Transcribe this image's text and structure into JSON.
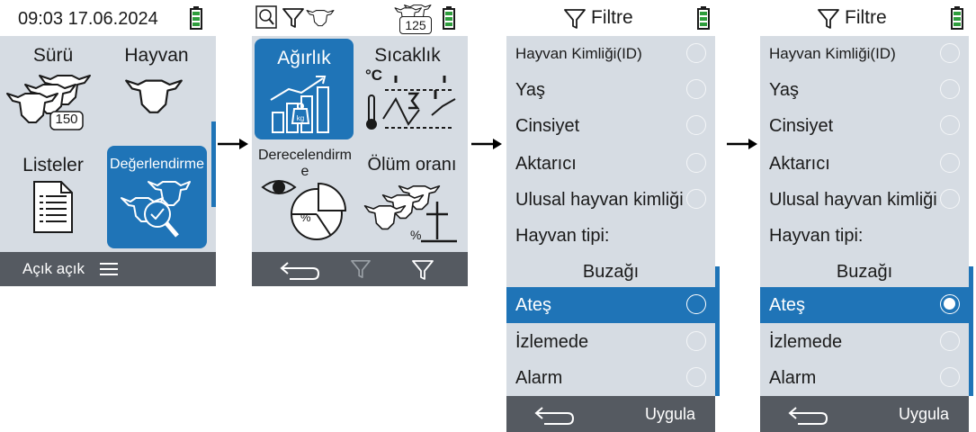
{
  "screen1": {
    "status": {
      "time_date": "09:03 17.06.2024"
    },
    "tiles": [
      {
        "label": "Sürü",
        "badge": "150"
      },
      {
        "label": "Hayvan"
      },
      {
        "label": "Listeler"
      },
      {
        "label": "Değerlendirme"
      }
    ],
    "bottom": {
      "label": "Açık açık"
    }
  },
  "screen2": {
    "status": {
      "badge": "125"
    },
    "tiles": [
      {
        "label": "Ağırlık",
        "unit": "kg"
      },
      {
        "label": "Sıcaklık",
        "unit": "°C"
      },
      {
        "label_line1": "Derecelendirm",
        "label_line2": "e"
      },
      {
        "label": "Ölüm oranı"
      }
    ]
  },
  "screen3": {
    "title": "Filtre",
    "items": [
      "Hayvan Kimliği(ID)",
      "Yaş",
      "Cinsiyet",
      "Aktarıcı",
      "Ulusal hayvan kimliği",
      "Hayvan tipi:",
      "Buzağı",
      "Ateş",
      "İzlemede",
      "Alarm"
    ],
    "apply_label": "Uygula"
  },
  "screen4": {
    "title": "Filtre",
    "items": [
      "Hayvan Kimliği(ID)",
      "Yaş",
      "Cinsiyet",
      "Aktarıcı",
      "Ulusal hayvan kimliği",
      "Hayvan tipi:",
      "Buzağı",
      "Ateş",
      "İzlemede",
      "Alarm"
    ],
    "apply_label": "Uygula"
  },
  "colors": {
    "accent": "#1f74b7",
    "panel": "#d6dce3",
    "bar": "#555a61",
    "battery": "#2e9d3c"
  },
  "icons": [
    "battery-icon",
    "filter-icon",
    "cow-head-icon",
    "herd-icon",
    "list-document-icon",
    "evaluation-icon",
    "menu-icon",
    "back-arrow-icon",
    "weight-chart-icon",
    "temperature-chart-icon",
    "rating-pie-icon",
    "mortality-icon"
  ]
}
